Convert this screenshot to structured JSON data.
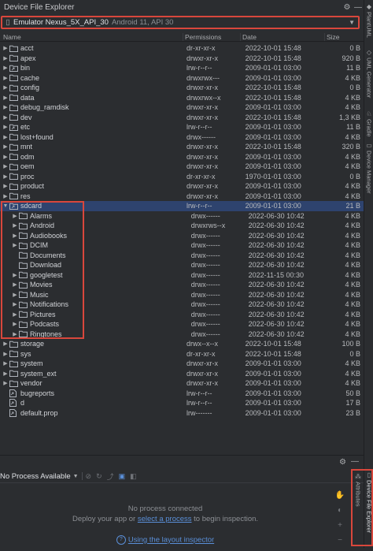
{
  "window": {
    "title": "Device File Explorer"
  },
  "device": {
    "name": "Emulator Nexus_5X_API_30",
    "detail": "Android 11, API 30"
  },
  "columns": {
    "name": "Name",
    "permissions": "Permissions",
    "date": "Date",
    "size": "Size"
  },
  "files": [
    {
      "name": "acct",
      "perm": "dr-xr-xr-x",
      "date": "2022-10-01 15:48",
      "size": "0 B",
      "kind": "folder",
      "depth": 0,
      "expandable": true
    },
    {
      "name": "apex",
      "perm": "drwxr-xr-x",
      "date": "2022-10-01 15:48",
      "size": "920 B",
      "kind": "folder",
      "depth": 0,
      "expandable": true
    },
    {
      "name": "bin",
      "perm": "lrw-r--r--",
      "date": "2009-01-01 03:00",
      "size": "11 B",
      "kind": "link",
      "depth": 0,
      "expandable": true
    },
    {
      "name": "cache",
      "perm": "drwxrwx---",
      "date": "2009-01-01 03:00",
      "size": "4 KB",
      "kind": "folder",
      "depth": 0,
      "expandable": true
    },
    {
      "name": "config",
      "perm": "drwxr-xr-x",
      "date": "2022-10-01 15:48",
      "size": "0 B",
      "kind": "folder",
      "depth": 0,
      "expandable": true
    },
    {
      "name": "data",
      "perm": "drwxrwx--x",
      "date": "2022-10-01 15:48",
      "size": "4 KB",
      "kind": "folder",
      "depth": 0,
      "expandable": true
    },
    {
      "name": "debug_ramdisk",
      "perm": "drwxr-xr-x",
      "date": "2009-01-01 03:00",
      "size": "4 KB",
      "kind": "folder",
      "depth": 0,
      "expandable": true
    },
    {
      "name": "dev",
      "perm": "drwxr-xr-x",
      "date": "2022-10-01 15:48",
      "size": "1,3 KB",
      "kind": "folder",
      "depth": 0,
      "expandable": true
    },
    {
      "name": "etc",
      "perm": "lrw-r--r--",
      "date": "2009-01-01 03:00",
      "size": "11 B",
      "kind": "link",
      "depth": 0,
      "expandable": true
    },
    {
      "name": "lost+found",
      "perm": "drwx------",
      "date": "2009-01-01 03:00",
      "size": "4 KB",
      "kind": "folder",
      "depth": 0,
      "expandable": true
    },
    {
      "name": "mnt",
      "perm": "drwxr-xr-x",
      "date": "2022-10-01 15:48",
      "size": "320 B",
      "kind": "folder",
      "depth": 0,
      "expandable": true
    },
    {
      "name": "odm",
      "perm": "drwxr-xr-x",
      "date": "2009-01-01 03:00",
      "size": "4 KB",
      "kind": "folder",
      "depth": 0,
      "expandable": true
    },
    {
      "name": "oem",
      "perm": "drwxr-xr-x",
      "date": "2009-01-01 03:00",
      "size": "4 KB",
      "kind": "folder",
      "depth": 0,
      "expandable": true
    },
    {
      "name": "proc",
      "perm": "dr-xr-xr-x",
      "date": "1970-01-01 03:00",
      "size": "0 B",
      "kind": "folder",
      "depth": 0,
      "expandable": true
    },
    {
      "name": "product",
      "perm": "drwxr-xr-x",
      "date": "2009-01-01 03:00",
      "size": "4 KB",
      "kind": "folder",
      "depth": 0,
      "expandable": true
    },
    {
      "name": "res",
      "perm": "drwxr-xr-x",
      "date": "2009-01-01 03:00",
      "size": "4 KB",
      "kind": "folder",
      "depth": 0,
      "expandable": true
    },
    {
      "name": "sdcard",
      "perm": "lrw-r--r--",
      "date": "2009-01-01 03:00",
      "size": "21 B",
      "kind": "link",
      "depth": 0,
      "expandable": true,
      "expanded": true,
      "selected": true
    },
    {
      "name": "Alarms",
      "perm": "drwx------",
      "date": "2022-06-30 10:42",
      "size": "4 KB",
      "kind": "folder",
      "depth": 1,
      "expandable": true
    },
    {
      "name": "Android",
      "perm": "drwxrws--x",
      "date": "2022-06-30 10:42",
      "size": "4 KB",
      "kind": "folder",
      "depth": 1,
      "expandable": true
    },
    {
      "name": "Audiobooks",
      "perm": "drwx------",
      "date": "2022-06-30 10:42",
      "size": "4 KB",
      "kind": "folder",
      "depth": 1,
      "expandable": true
    },
    {
      "name": "DCIM",
      "perm": "drwx------",
      "date": "2022-06-30 10:42",
      "size": "4 KB",
      "kind": "folder",
      "depth": 1,
      "expandable": true
    },
    {
      "name": "Documents",
      "perm": "drwx------",
      "date": "2022-06-30 10:42",
      "size": "4 KB",
      "kind": "folder",
      "depth": 1,
      "expandable": false
    },
    {
      "name": "Download",
      "perm": "drwx------",
      "date": "2022-06-30 10:42",
      "size": "4 KB",
      "kind": "folder",
      "depth": 1,
      "expandable": false
    },
    {
      "name": "googletest",
      "perm": "drwx------",
      "date": "2022-11-15 00:30",
      "size": "4 KB",
      "kind": "folder",
      "depth": 1,
      "expandable": true
    },
    {
      "name": "Movies",
      "perm": "drwx------",
      "date": "2022-06-30 10:42",
      "size": "4 KB",
      "kind": "folder",
      "depth": 1,
      "expandable": true
    },
    {
      "name": "Music",
      "perm": "drwx------",
      "date": "2022-06-30 10:42",
      "size": "4 KB",
      "kind": "folder",
      "depth": 1,
      "expandable": true
    },
    {
      "name": "Notifications",
      "perm": "drwx------",
      "date": "2022-06-30 10:42",
      "size": "4 KB",
      "kind": "folder",
      "depth": 1,
      "expandable": true
    },
    {
      "name": "Pictures",
      "perm": "drwx------",
      "date": "2022-06-30 10:42",
      "size": "4 KB",
      "kind": "folder",
      "depth": 1,
      "expandable": true
    },
    {
      "name": "Podcasts",
      "perm": "drwx------",
      "date": "2022-06-30 10:42",
      "size": "4 KB",
      "kind": "folder",
      "depth": 1,
      "expandable": true
    },
    {
      "name": "Ringtones",
      "perm": "drwx------",
      "date": "2022-06-30 10:42",
      "size": "4 KB",
      "kind": "folder",
      "depth": 1,
      "expandable": true
    },
    {
      "name": "storage",
      "perm": "drwx--x--x",
      "date": "2022-10-01 15:48",
      "size": "100 B",
      "kind": "folder",
      "depth": 0,
      "expandable": true
    },
    {
      "name": "sys",
      "perm": "dr-xr-xr-x",
      "date": "2022-10-01 15:48",
      "size": "0 B",
      "kind": "folder",
      "depth": 0,
      "expandable": true
    },
    {
      "name": "system",
      "perm": "drwxr-xr-x",
      "date": "2009-01-01 03:00",
      "size": "4 KB",
      "kind": "folder",
      "depth": 0,
      "expandable": true
    },
    {
      "name": "system_ext",
      "perm": "drwxr-xr-x",
      "date": "2009-01-01 03:00",
      "size": "4 KB",
      "kind": "folder",
      "depth": 0,
      "expandable": true
    },
    {
      "name": "vendor",
      "perm": "drwxr-xr-x",
      "date": "2009-01-01 03:00",
      "size": "4 KB",
      "kind": "folder",
      "depth": 0,
      "expandable": true
    },
    {
      "name": "bugreports",
      "perm": "lrw-r--r--",
      "date": "2009-01-01 03:00",
      "size": "50 B",
      "kind": "linkfile",
      "depth": 0,
      "expandable": false
    },
    {
      "name": "d",
      "perm": "lrw-r--r--",
      "date": "2009-01-01 03:00",
      "size": "17 B",
      "kind": "linkfile",
      "depth": 0,
      "expandable": false
    },
    {
      "name": "default.prop",
      "perm": "lrw-------",
      "date": "2009-01-01 03:00",
      "size": "23 B",
      "kind": "linkfile",
      "depth": 0,
      "expandable": false
    }
  ],
  "inspector": {
    "process_selector": "No Process Available",
    "no_process": "No process connected",
    "deploy_prefix": "Deploy your app or",
    "deploy_link": "select a process",
    "deploy_suffix": "to begin inspection.",
    "help_link": "Using the layout inspector"
  },
  "right_strip": {
    "tabs": [
      "PlantUML",
      "UML Generator",
      "Gradle",
      "Device Manager",
      "Device File Explorer",
      "Attributes"
    ]
  },
  "colors": {
    "accent": "#5a8fd8",
    "highlight": "#d9473c",
    "selection": "#2e436e",
    "folder": "#aeb3bb"
  }
}
